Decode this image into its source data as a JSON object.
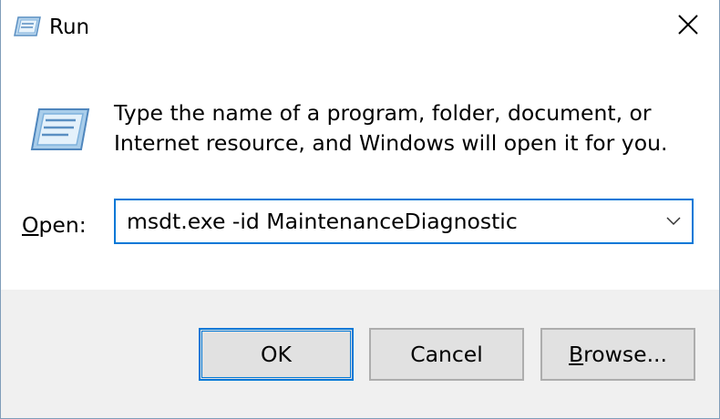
{
  "window": {
    "title": "Run",
    "title_icon": "run-app-icon",
    "close_icon": "close-icon"
  },
  "content": {
    "icon": "run-program-icon",
    "description": "Type the name of a program, folder, document, or Internet resource, and Windows will open it for you.",
    "open_label_mnemonic": "O",
    "open_label_rest": "pen:",
    "combo_value": "msdt.exe -id MaintenanceDiagnostic",
    "combo_arrow_icon": "chevron-down-icon"
  },
  "buttons": {
    "ok_label": "OK",
    "cancel_label": "Cancel",
    "browse_mnemonic": "B",
    "browse_rest": "rowse..."
  },
  "colors": {
    "accent": "#0078d7",
    "footer_bg": "#f0f0f0",
    "button_bg": "#e1e1e1",
    "button_border": "#adadad"
  }
}
